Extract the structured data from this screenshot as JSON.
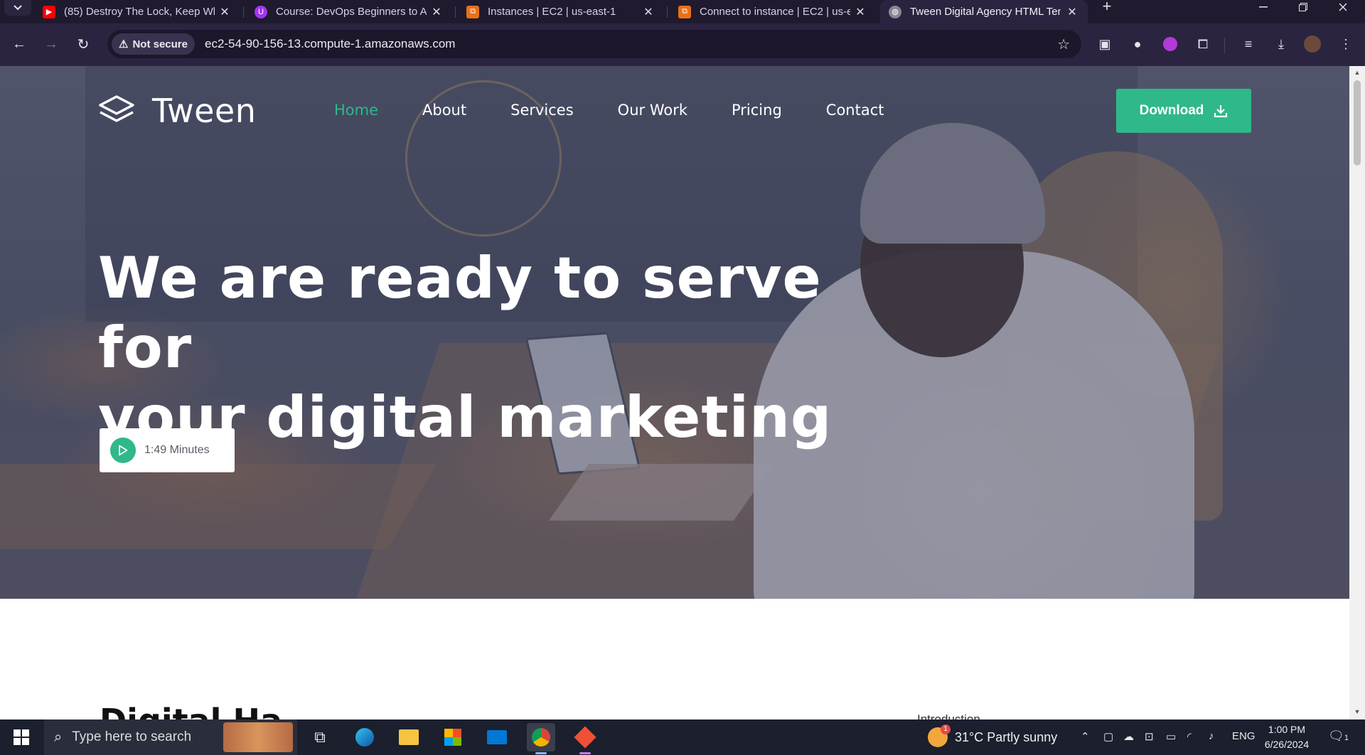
{
  "browser": {
    "tabs": [
      {
        "title": "(85) Destroy The Lock, Keep Wh",
        "favicon": "youtube-icon",
        "color": "#ff0000"
      },
      {
        "title": "Course: DevOps Beginners to A",
        "favicon": "udemy-icon",
        "color": "#a435f0"
      },
      {
        "title": "Instances | EC2 | us-east-1",
        "favicon": "aws-icon",
        "color": "#e8701a"
      },
      {
        "title": "Connect to instance | EC2 | us-e",
        "favicon": "aws-icon",
        "color": "#e8701a"
      },
      {
        "title": "Tween Digital Agency HTML Ten",
        "favicon": "globe-icon",
        "color": "#8a8596"
      }
    ],
    "security_label": "Not secure",
    "url": "ec2-54-90-156-13.compute-1.amazonaws.com"
  },
  "site": {
    "brand": "Tween",
    "nav": [
      "Home",
      "About",
      "Services",
      "Our Work",
      "Pricing",
      "Contact"
    ],
    "active_nav": "Home",
    "download_label": "Download",
    "hero_line1": "We are ready to serve for",
    "hero_line2": "your digital marketing",
    "video_duration": "1:49 Minutes",
    "section_heading": "Digital Ha",
    "section_side": "Introduction",
    "accent_color": "#2fb88a"
  },
  "taskbar": {
    "search_placeholder": "Type here to search",
    "weather": "31°C  Partly sunny",
    "weather_badge": "1",
    "language": "ENG",
    "time": "1:00 PM",
    "date": "6/26/2024",
    "notification_count": "1"
  }
}
